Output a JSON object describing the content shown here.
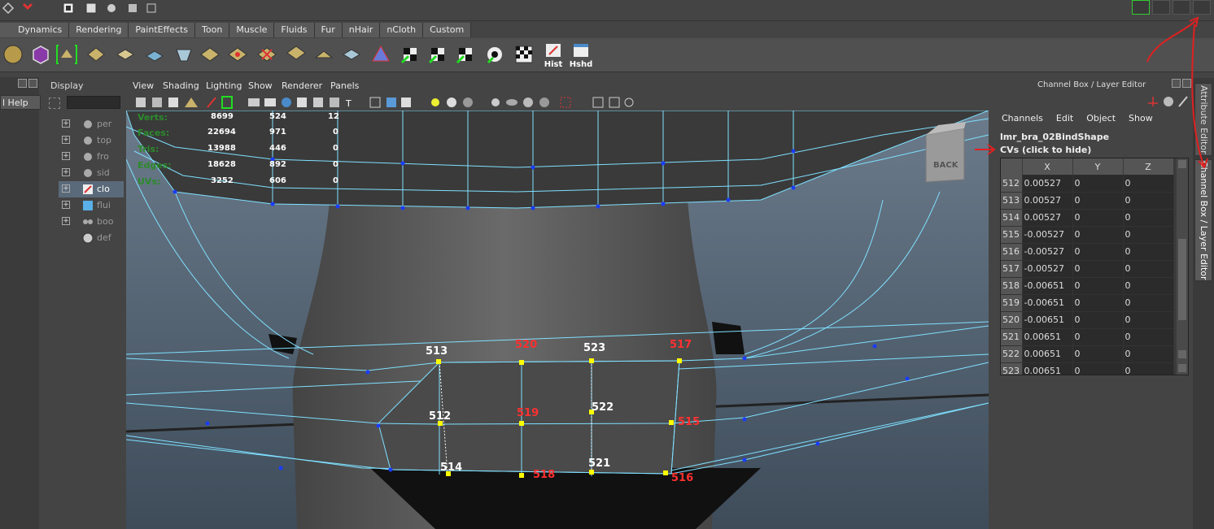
{
  "shelf_tabs": [
    "Dynamics",
    "Rendering",
    "PaintEffects",
    "Toon",
    "Muscle",
    "Fluids",
    "Fur",
    "nHair",
    "nCloth",
    "Custom"
  ],
  "shelf_buttons": {
    "hist": "Hist",
    "hshd": "Hshd"
  },
  "outliner": {
    "title": "Display",
    "help_label": "l Help",
    "items": [
      {
        "name": "per",
        "selected": false
      },
      {
        "name": "top",
        "selected": false
      },
      {
        "name": "fro",
        "selected": false
      },
      {
        "name": "sid",
        "selected": false
      },
      {
        "name": "clo",
        "selected": true
      },
      {
        "name": "flui",
        "selected": false
      },
      {
        "name": "boo",
        "selected": false
      },
      {
        "name": "def",
        "selected": false
      }
    ]
  },
  "viewport": {
    "menus": [
      "View",
      "Shading",
      "Lighting",
      "Show",
      "Renderer",
      "Panels"
    ],
    "hud": {
      "labels": [
        "Verts:",
        "Faces:",
        "Tris:",
        "Edges:",
        "UVs:"
      ],
      "col1": [
        "8699",
        "22694",
        "13988",
        "18628",
        "3252"
      ],
      "col2": [
        "524",
        "971",
        "446",
        "892",
        "606"
      ],
      "col3": [
        "12",
        "0",
        "0",
        "0",
        "0"
      ]
    },
    "view_cube_label": "BACK",
    "vertex_labels": [
      {
        "text": "513",
        "color": "#ffffff"
      },
      {
        "text": "520",
        "color": "#ff3030"
      },
      {
        "text": "523",
        "color": "#ffffff"
      },
      {
        "text": "517",
        "color": "#ff3030"
      },
      {
        "text": "512",
        "color": "#ffffff"
      },
      {
        "text": "519",
        "color": "#ff3030"
      },
      {
        "text": "522",
        "color": "#ffffff"
      },
      {
        "text": "515",
        "color": "#ff3030"
      },
      {
        "text": "514",
        "color": "#ffffff"
      },
      {
        "text": "518",
        "color": "#ff3030"
      },
      {
        "text": "521",
        "color": "#ffffff"
      },
      {
        "text": "516",
        "color": "#ff3030"
      }
    ]
  },
  "channel_box": {
    "title": "Channel Box / Layer Editor",
    "menus": [
      "Channels",
      "Edit",
      "Object",
      "Show"
    ],
    "node_name": "lmr_bra_02BindShape",
    "cv_label": "CVs (click to hide)",
    "columns": [
      "X",
      "Y",
      "Z"
    ],
    "rows": [
      {
        "idx": "512",
        "x": "0.00527",
        "y": "0",
        "z": "0"
      },
      {
        "idx": "513",
        "x": "0.00527",
        "y": "0",
        "z": "0"
      },
      {
        "idx": "514",
        "x": "0.00527",
        "y": "0",
        "z": "0"
      },
      {
        "idx": "515",
        "x": "-0.00527",
        "y": "0",
        "z": "0"
      },
      {
        "idx": "516",
        "x": "-0.00527",
        "y": "0",
        "z": "0"
      },
      {
        "idx": "517",
        "x": "-0.00527",
        "y": "0",
        "z": "0"
      },
      {
        "idx": "518",
        "x": "-0.00651",
        "y": "0",
        "z": "0"
      },
      {
        "idx": "519",
        "x": "-0.00651",
        "y": "0",
        "z": "0"
      },
      {
        "idx": "520",
        "x": "-0.00651",
        "y": "0",
        "z": "0"
      },
      {
        "idx": "521",
        "x": "0.00651",
        "y": "0",
        "z": "0"
      },
      {
        "idx": "522",
        "x": "0.00651",
        "y": "0",
        "z": "0"
      },
      {
        "idx": "523",
        "x": "0.00651",
        "y": "0",
        "z": "0"
      }
    ]
  },
  "side_tabs": {
    "attribute_editor": "Attribute Editor",
    "channel_box": "Channel Box / Layer Editor"
  },
  "colors": {
    "wire": "#7fe0ff",
    "vertex": "#1a3cff",
    "selected_vertex": "#ffff00",
    "annotation": "#e02020"
  }
}
